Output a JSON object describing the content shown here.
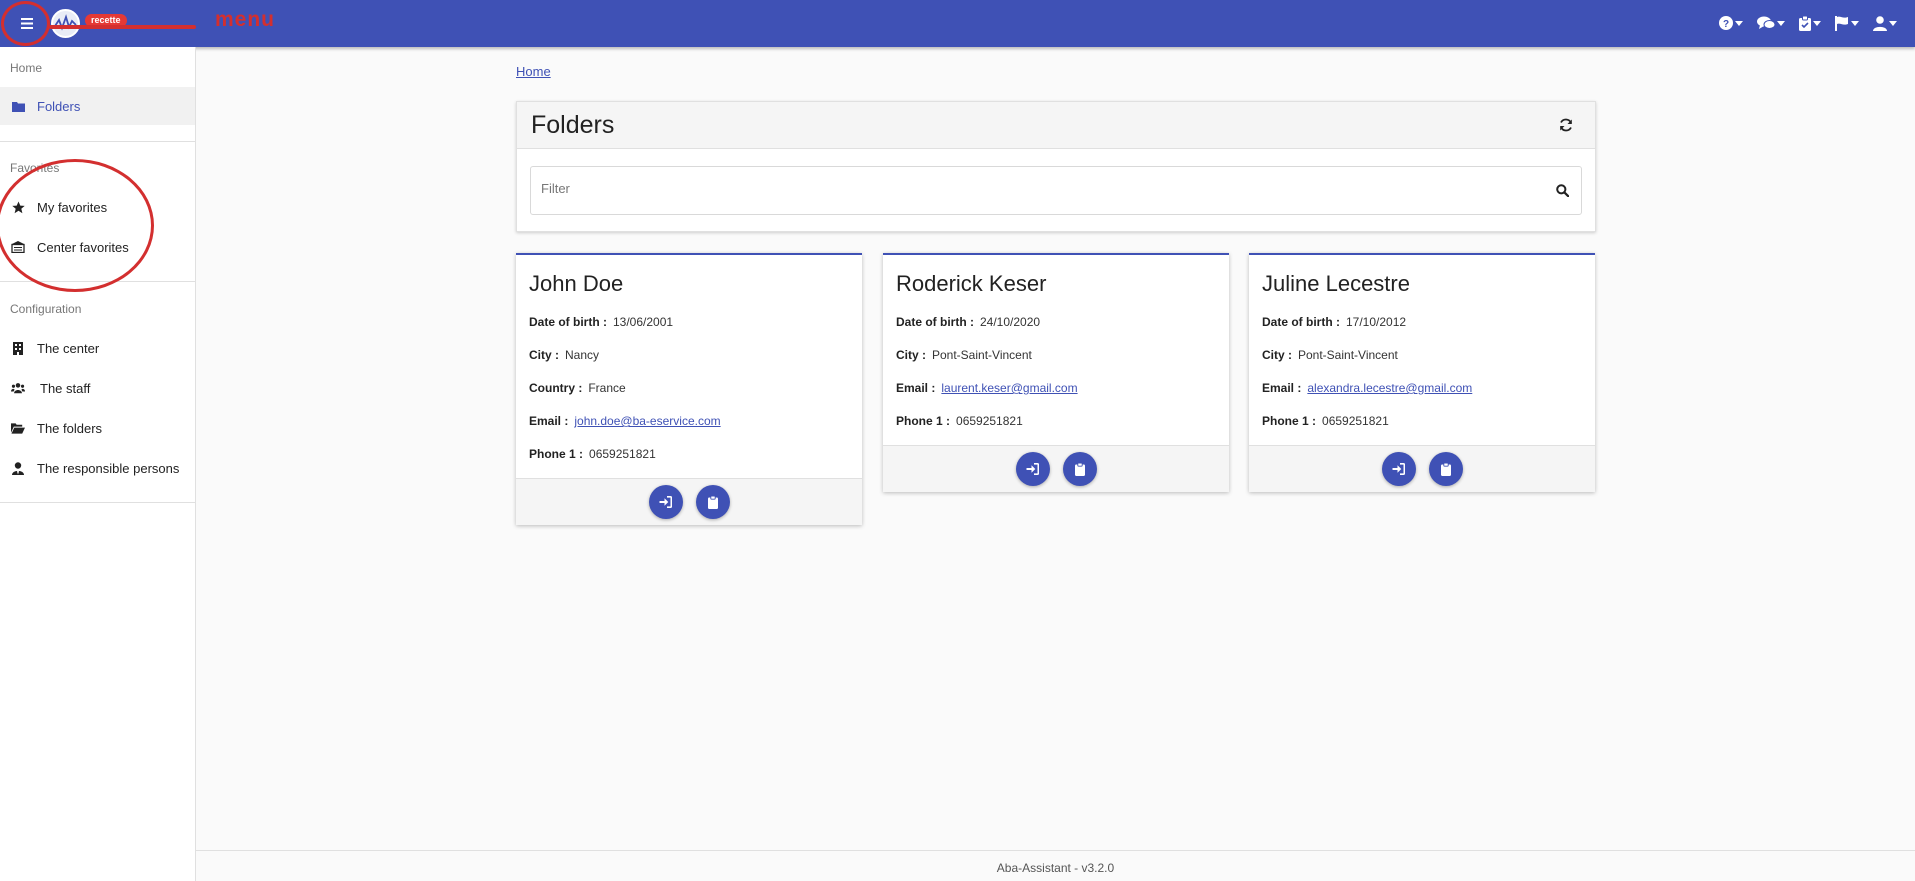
{
  "topbar": {
    "env_badge": "recette",
    "annotation_label": "menu",
    "icons": [
      "help-icon",
      "chat-icon",
      "clipboard-check-icon",
      "flag-icon",
      "user-icon"
    ]
  },
  "sidebar": {
    "home_title": "Home",
    "home_items": [
      {
        "label": "Folders",
        "icon": "folder-icon"
      }
    ],
    "favorites_title": "Favorites",
    "favorites_items": [
      {
        "label": "My favorites",
        "icon": "star-icon"
      },
      {
        "label": "Center favorites",
        "icon": "building-icon"
      }
    ],
    "config_title": "Configuration",
    "config_items": [
      {
        "label": "The center",
        "icon": "building-icon"
      },
      {
        "label": "The staff",
        "icon": "users-icon"
      },
      {
        "label": "The folders",
        "icon": "folder-open-icon"
      },
      {
        "label": "The responsible persons",
        "icon": "user-tie-icon"
      }
    ]
  },
  "breadcrumb": "Home",
  "panel": {
    "title": "Folders",
    "filter_placeholder": "Filter",
    "filter_value": ""
  },
  "cards": [
    {
      "name": "John Doe",
      "fields": [
        {
          "label": "Date of birth :",
          "value": "13/06/2001"
        },
        {
          "label": "City :",
          "value": "Nancy"
        },
        {
          "label": "Country :",
          "value": "France"
        },
        {
          "label": "Email :",
          "value": "john.doe@ba-eservice.com",
          "link": true
        },
        {
          "label": "Phone 1 :",
          "value": "0659251821"
        }
      ]
    },
    {
      "name": "Roderick Keser",
      "fields": [
        {
          "label": "Date of birth :",
          "value": "24/10/2020"
        },
        {
          "label": "City :",
          "value": "Pont-Saint-Vincent"
        },
        {
          "label": "Email :",
          "value": "laurent.keser@gmail.com",
          "link": true
        },
        {
          "label": "Phone 1 :",
          "value": "0659251821"
        }
      ]
    },
    {
      "name": "Juline Lecestre",
      "fields": [
        {
          "label": "Date of birth :",
          "value": "17/10/2012"
        },
        {
          "label": "City :",
          "value": "Pont-Saint-Vincent"
        },
        {
          "label": "Email :",
          "value": "alexandra.lecestre@gmail.com",
          "link": true
        },
        {
          "label": "Phone 1 :",
          "value": "0659251821"
        }
      ]
    }
  ],
  "footer": "Aba-Assistant - v3.2.0",
  "colors": {
    "primary": "#3f51b5",
    "annotation": "#d32f2f",
    "badge": "#e53935"
  }
}
